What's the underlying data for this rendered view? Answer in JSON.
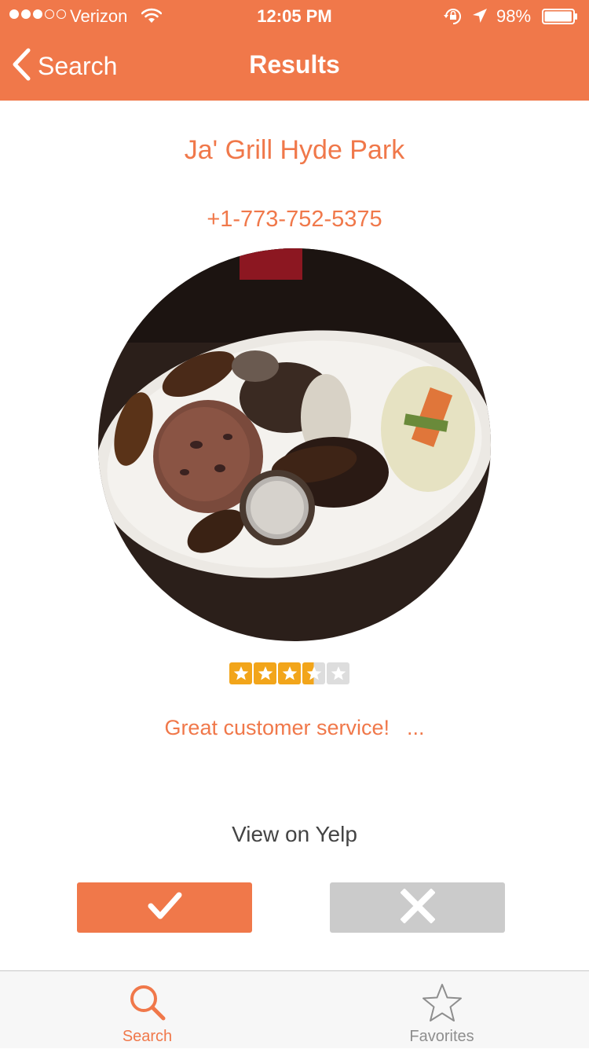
{
  "status_bar": {
    "signal_bars_filled": 3,
    "signal_bars_total": 5,
    "carrier": "Verizon",
    "time": "12:05 PM",
    "battery_percent": "98%",
    "battery_level": 0.98
  },
  "nav": {
    "back_label": "Search",
    "title": "Results"
  },
  "business": {
    "name": "Ja' Grill Hyde Park",
    "phone": "+1-773-752-5375",
    "rating": 3.5,
    "rating_max": 5,
    "snippet": "Great customer service!",
    "snippet_more": "..."
  },
  "actions": {
    "yelp_link": "View on Yelp",
    "accept_icon": "checkmark-icon",
    "reject_icon": "x-icon"
  },
  "tabs": [
    {
      "label": "Search",
      "icon": "search-icon",
      "selected": true
    },
    {
      "label": "Favorites",
      "icon": "star-icon",
      "selected": false
    }
  ],
  "colors": {
    "accent": "#F0784A",
    "reject_gray": "#CBCBCB",
    "tab_inactive": "#8E8E8E",
    "star_filled": "#F2A51A",
    "star_empty": "#DDDDDD"
  }
}
